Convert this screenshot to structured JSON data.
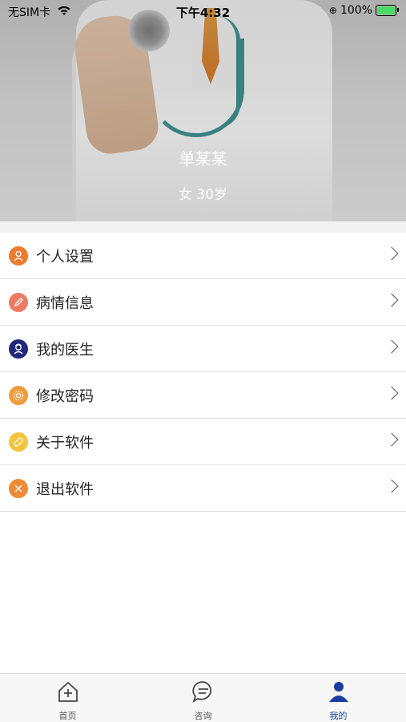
{
  "status_bar": {
    "carrier": "无SIM卡",
    "time": "下午4:32",
    "battery": "100%"
  },
  "profile": {
    "name": "单某某",
    "info": "女  30岁"
  },
  "menu": [
    {
      "label": "个人设置",
      "icon": "person-icon",
      "color": "#f07a2e"
    },
    {
      "label": "病情信息",
      "icon": "pencil-icon",
      "color": "#ef7a63"
    },
    {
      "label": "我的医生",
      "icon": "doctor-icon",
      "color": "#1f2a7a"
    },
    {
      "label": "修改密码",
      "icon": "gear-icon",
      "color": "#f39a3c"
    },
    {
      "label": "关于软件",
      "icon": "info-pill-icon",
      "color": "#f6c43a"
    },
    {
      "label": "退出软件",
      "icon": "close-icon",
      "color": "#f08a36"
    }
  ],
  "tabbar": {
    "home": "首页",
    "consult": "咨询",
    "mine": "我的",
    "active_color": "#1a3fa0"
  }
}
